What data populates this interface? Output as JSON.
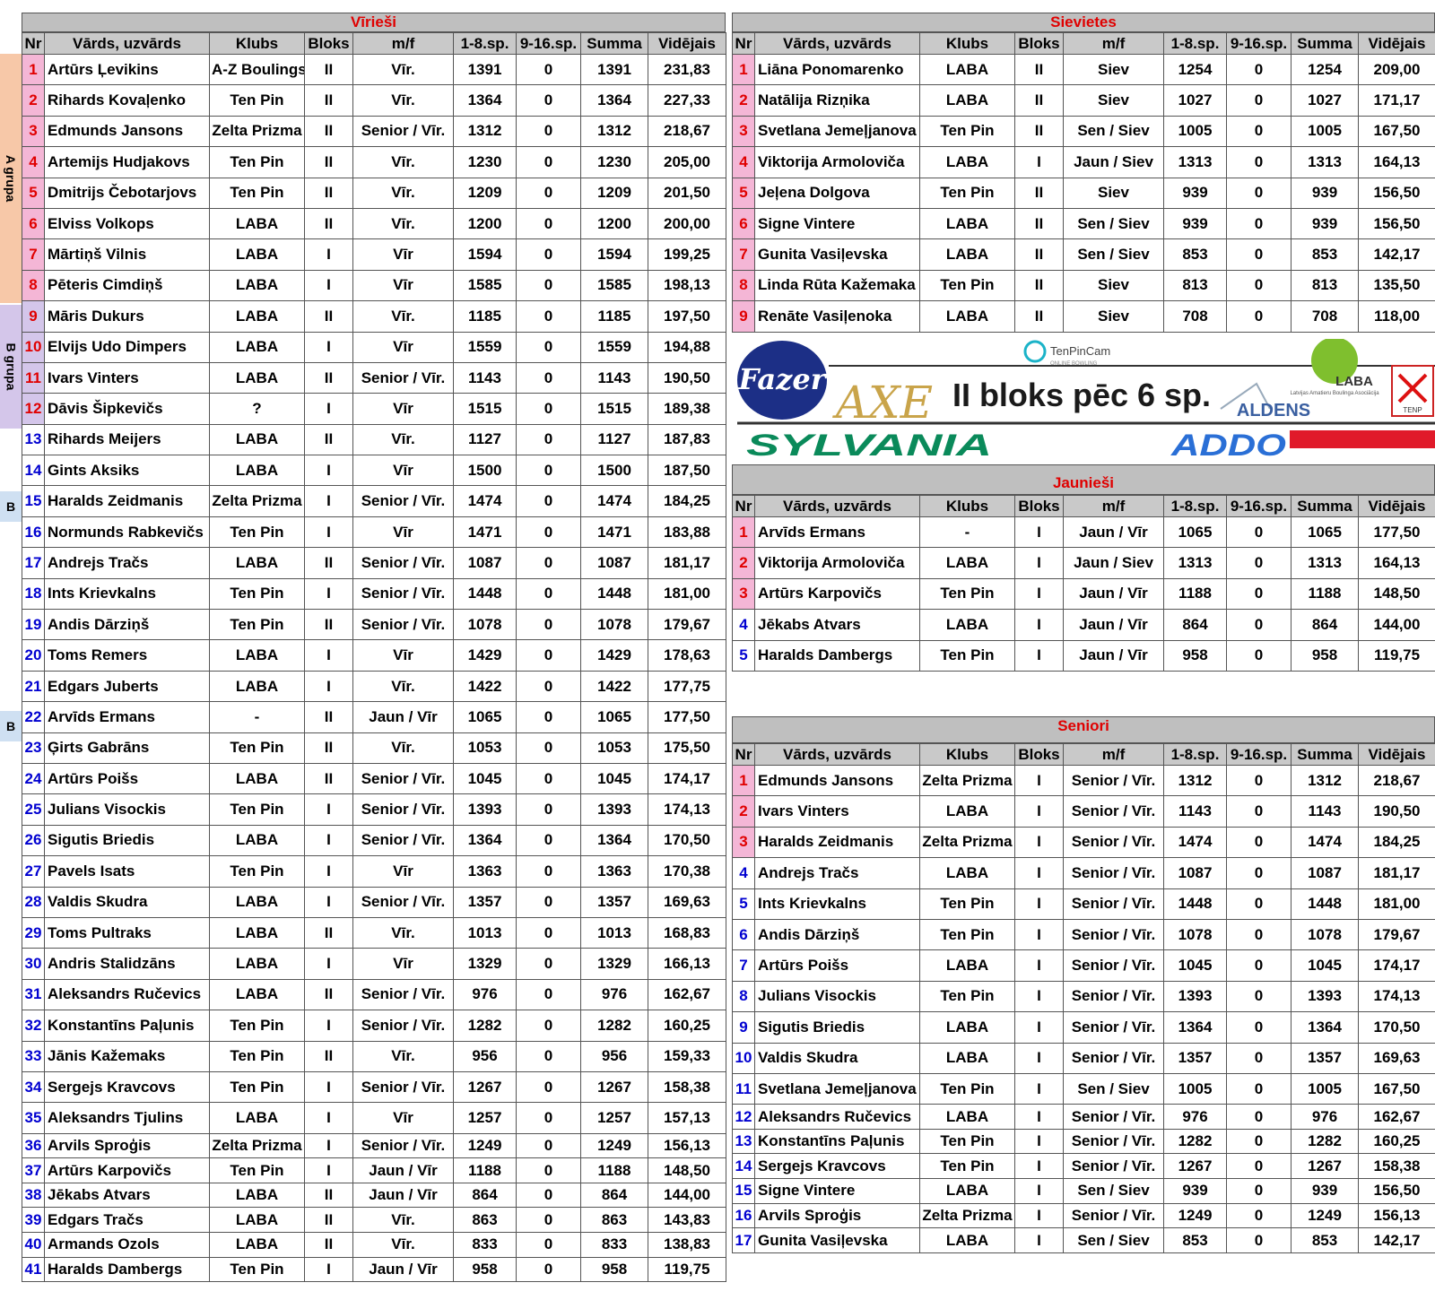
{
  "headers": [
    "Nr",
    "Vārds, uzvārds",
    "Klubs",
    "Bloks",
    "m/f",
    "1-8.sp.",
    "9-16.sp.",
    "Summa",
    "Vidējais"
  ],
  "side_labels": {
    "a_group": "A grupa",
    "b_group": "B grupa",
    "b1": "B",
    "b2": "B"
  },
  "men": {
    "title": "Vīrieši",
    "rows": [
      [
        "1",
        "Artūrs Ļevikins",
        "A-Z Boulings",
        "II",
        "Vīr.",
        "1391",
        "0",
        "1391",
        "231,83"
      ],
      [
        "2",
        "Rihards Kovaļenko",
        "Ten Pin",
        "II",
        "Vīr.",
        "1364",
        "0",
        "1364",
        "227,33"
      ],
      [
        "3",
        "Edmunds Jansons",
        "Zelta Prizma",
        "II",
        "Senior / Vīr.",
        "1312",
        "0",
        "1312",
        "218,67"
      ],
      [
        "4",
        "Artemijs Hudjakovs",
        "Ten Pin",
        "II",
        "Vīr.",
        "1230",
        "0",
        "1230",
        "205,00"
      ],
      [
        "5",
        "Dmitrijs Čebotarjovs",
        "Ten Pin",
        "II",
        "Vīr.",
        "1209",
        "0",
        "1209",
        "201,50"
      ],
      [
        "6",
        "Elviss Volkops",
        "LABA",
        "II",
        "Vīr.",
        "1200",
        "0",
        "1200",
        "200,00"
      ],
      [
        "7",
        "Mārtiņš Vilnis",
        "LABA",
        "I",
        "Vīr",
        "1594",
        "0",
        "1594",
        "199,25"
      ],
      [
        "8",
        "Pēteris Cimdiņš",
        "LABA",
        "I",
        "Vīr",
        "1585",
        "0",
        "1585",
        "198,13"
      ],
      [
        "9",
        "Māris Dukurs",
        "LABA",
        "II",
        "Vīr.",
        "1185",
        "0",
        "1185",
        "197,50"
      ],
      [
        "10",
        "Elvijs Udo Dimpers",
        "LABA",
        "I",
        "Vīr",
        "1559",
        "0",
        "1559",
        "194,88"
      ],
      [
        "11",
        "Ivars Vinters",
        "LABA",
        "II",
        "Senior / Vīr.",
        "1143",
        "0",
        "1143",
        "190,50"
      ],
      [
        "12",
        "Dāvis Šipkevičs",
        "?",
        "I",
        "Vīr",
        "1515",
        "0",
        "1515",
        "189,38"
      ],
      [
        "13",
        "Rihards Meijers",
        "LABA",
        "II",
        "Vīr.",
        "1127",
        "0",
        "1127",
        "187,83"
      ],
      [
        "14",
        "Gints Aksiks",
        "LABA",
        "I",
        "Vīr",
        "1500",
        "0",
        "1500",
        "187,50"
      ],
      [
        "15",
        "Haralds Zeidmanis",
        "Zelta Prizma",
        "I",
        "Senior / Vīr.",
        "1474",
        "0",
        "1474",
        "184,25"
      ],
      [
        "16",
        "Normunds Rabkevičs",
        "Ten Pin",
        "I",
        "Vīr",
        "1471",
        "0",
        "1471",
        "183,88"
      ],
      [
        "17",
        "Andrejs Tračs",
        "LABA",
        "II",
        "Senior / Vīr.",
        "1087",
        "0",
        "1087",
        "181,17"
      ],
      [
        "18",
        "Ints Krievkalns",
        "Ten Pin",
        "I",
        "Senior / Vīr.",
        "1448",
        "0",
        "1448",
        "181,00"
      ],
      [
        "19",
        "Andis Dārziņš",
        "Ten Pin",
        "II",
        "Senior / Vīr.",
        "1078",
        "0",
        "1078",
        "179,67"
      ],
      [
        "20",
        "Toms Remers",
        "LABA",
        "I",
        "Vīr",
        "1429",
        "0",
        "1429",
        "178,63"
      ],
      [
        "21",
        "Edgars Juberts",
        "LABA",
        "I",
        "Vīr.",
        "1422",
        "0",
        "1422",
        "177,75"
      ],
      [
        "22",
        "Arvīds Ermans",
        "-",
        "II",
        "Jaun / Vīr",
        "1065",
        "0",
        "1065",
        "177,50"
      ],
      [
        "23",
        "Ģirts Gabrāns",
        "Ten Pin",
        "II",
        "Vīr.",
        "1053",
        "0",
        "1053",
        "175,50"
      ],
      [
        "24",
        "Artūrs Poišs",
        "LABA",
        "II",
        "Senior / Vīr.",
        "1045",
        "0",
        "1045",
        "174,17"
      ],
      [
        "25",
        "Julians Visockis",
        "Ten Pin",
        "I",
        "Senior / Vīr.",
        "1393",
        "0",
        "1393",
        "174,13"
      ],
      [
        "26",
        "Sigutis Briedis",
        "LABA",
        "I",
        "Senior / Vīr.",
        "1364",
        "0",
        "1364",
        "170,50"
      ],
      [
        "27",
        "Pavels Isats",
        "Ten Pin",
        "I",
        "Vīr",
        "1363",
        "0",
        "1363",
        "170,38"
      ],
      [
        "28",
        "Valdis Skudra",
        "LABA",
        "I",
        "Senior / Vīr.",
        "1357",
        "0",
        "1357",
        "169,63"
      ],
      [
        "29",
        "Toms Pultraks",
        "LABA",
        "II",
        "Vīr.",
        "1013",
        "0",
        "1013",
        "168,83"
      ],
      [
        "30",
        "Andris Stalidzāns",
        "LABA",
        "I",
        "Vīr",
        "1329",
        "0",
        "1329",
        "166,13"
      ],
      [
        "31",
        "Aleksandrs Ručevics",
        "LABA",
        "II",
        "Senior / Vīr.",
        "976",
        "0",
        "976",
        "162,67"
      ],
      [
        "32",
        "Konstantīns Paļunis",
        "Ten Pin",
        "I",
        "Senior / Vīr.",
        "1282",
        "0",
        "1282",
        "160,25"
      ],
      [
        "33",
        "Jānis Kažemaks",
        "Ten Pin",
        "II",
        "Vīr.",
        "956",
        "0",
        "956",
        "159,33"
      ],
      [
        "34",
        "Sergejs Kravcovs",
        "Ten Pin",
        "I",
        "Senior / Vīr.",
        "1267",
        "0",
        "1267",
        "158,38"
      ],
      [
        "35",
        "Aleksandrs Tjulins",
        "LABA",
        "I",
        "Vīr",
        "1257",
        "0",
        "1257",
        "157,13"
      ],
      [
        "36",
        "Arvils Sproģis",
        "Zelta Prizma",
        "I",
        "Senior / Vīr.",
        "1249",
        "0",
        "1249",
        "156,13"
      ],
      [
        "37",
        "Artūrs Karpovičs",
        "Ten Pin",
        "I",
        "Jaun / Vīr",
        "1188",
        "0",
        "1188",
        "148,50"
      ],
      [
        "38",
        "Jēkabs Atvars",
        "LABA",
        "II",
        "Jaun / Vīr",
        "864",
        "0",
        "864",
        "144,00"
      ],
      [
        "39",
        "Edgars Tračs",
        "LABA",
        "II",
        "Vīr.",
        "863",
        "0",
        "863",
        "143,83"
      ],
      [
        "40",
        "Armands Ozols",
        "LABA",
        "II",
        "Vīr.",
        "833",
        "0",
        "833",
        "138,83"
      ],
      [
        "41",
        "Haralds Dambergs",
        "Ten Pin",
        "I",
        "Jaun / Vīr",
        "958",
        "0",
        "958",
        "119,75"
      ]
    ]
  },
  "women": {
    "title": "Sievietes",
    "rows": [
      [
        "1",
        "Liāna Ponomarenko",
        "LABA",
        "II",
        "Siev",
        "1254",
        "0",
        "1254",
        "209,00"
      ],
      [
        "2",
        "Natālija Rizņika",
        "LABA",
        "II",
        "Siev",
        "1027",
        "0",
        "1027",
        "171,17"
      ],
      [
        "3",
        "Svetlana Jemeļjanova",
        "Ten Pin",
        "II",
        "Sen / Siev",
        "1005",
        "0",
        "1005",
        "167,50"
      ],
      [
        "4",
        "Viktorija Armoloviča",
        "LABA",
        "I",
        "Jaun / Siev",
        "1313",
        "0",
        "1313",
        "164,13"
      ],
      [
        "5",
        "Jeļena Dolgova",
        "Ten Pin",
        "II",
        "Siev",
        "939",
        "0",
        "939",
        "156,50"
      ],
      [
        "6",
        "Signe Vintere",
        "LABA",
        "II",
        "Sen / Siev",
        "939",
        "0",
        "939",
        "156,50"
      ],
      [
        "7",
        "Gunita Vasiļevska",
        "LABA",
        "II",
        "Sen / Siev",
        "853",
        "0",
        "853",
        "142,17"
      ],
      [
        "8",
        "Linda Rūta Kažemaka",
        "Ten Pin",
        "II",
        "Siev",
        "813",
        "0",
        "813",
        "135,50"
      ],
      [
        "9",
        "Renāte Vasiļenoka",
        "LABA",
        "II",
        "Siev",
        "708",
        "0",
        "708",
        "118,00"
      ]
    ]
  },
  "juniors": {
    "title": "Jaunieši",
    "rows": [
      [
        "1",
        "Arvīds Ermans",
        "-",
        "I",
        "Jaun / Vīr",
        "1065",
        "0",
        "1065",
        "177,50"
      ],
      [
        "2",
        "Viktorija Armoloviča",
        "LABA",
        "I",
        "Jaun / Siev",
        "1313",
        "0",
        "1313",
        "164,13"
      ],
      [
        "3",
        "Artūrs Karpovičs",
        "Ten Pin",
        "I",
        "Jaun / Vīr",
        "1188",
        "0",
        "1188",
        "148,50"
      ],
      [
        "4",
        "Jēkabs Atvars",
        "LABA",
        "I",
        "Jaun / Vīr",
        "864",
        "0",
        "864",
        "144,00"
      ],
      [
        "5",
        "Haralds Dambergs",
        "Ten Pin",
        "I",
        "Jaun / Vīr",
        "958",
        "0",
        "958",
        "119,75"
      ]
    ]
  },
  "seniors": {
    "title": "Seniori",
    "rows": [
      [
        "1",
        "Edmunds Jansons",
        "Zelta Prizma",
        "I",
        "Senior / Vīr.",
        "1312",
        "0",
        "1312",
        "218,67"
      ],
      [
        "2",
        "Ivars Vinters",
        "LABA",
        "I",
        "Senior / Vīr.",
        "1143",
        "0",
        "1143",
        "190,50"
      ],
      [
        "3",
        "Haralds Zeidmanis",
        "Zelta Prizma",
        "I",
        "Senior / Vīr.",
        "1474",
        "0",
        "1474",
        "184,25"
      ],
      [
        "4",
        "Andrejs Tračs",
        "LABA",
        "I",
        "Senior / Vīr.",
        "1087",
        "0",
        "1087",
        "181,17"
      ],
      [
        "5",
        "Ints Krievkalns",
        "Ten Pin",
        "I",
        "Senior / Vīr.",
        "1448",
        "0",
        "1448",
        "181,00"
      ],
      [
        "6",
        "Andis Dārziņš",
        "Ten Pin",
        "I",
        "Senior / Vīr.",
        "1078",
        "0",
        "1078",
        "179,67"
      ],
      [
        "7",
        "Artūrs Poišs",
        "LABA",
        "I",
        "Senior / Vīr.",
        "1045",
        "0",
        "1045",
        "174,17"
      ],
      [
        "8",
        "Julians Visockis",
        "Ten Pin",
        "I",
        "Senior / Vīr.",
        "1393",
        "0",
        "1393",
        "174,13"
      ],
      [
        "9",
        "Sigutis Briedis",
        "LABA",
        "I",
        "Senior / Vīr.",
        "1364",
        "0",
        "1364",
        "170,50"
      ],
      [
        "10",
        "Valdis Skudra",
        "LABA",
        "I",
        "Senior / Vīr.",
        "1357",
        "0",
        "1357",
        "169,63"
      ],
      [
        "11",
        "Svetlana Jemeļjanova",
        "Ten Pin",
        "I",
        "Sen / Siev",
        "1005",
        "0",
        "1005",
        "167,50"
      ],
      [
        "12",
        "Aleksandrs Ručevics",
        "LABA",
        "I",
        "Senior / Vīr.",
        "976",
        "0",
        "976",
        "162,67"
      ],
      [
        "13",
        "Konstantīns Paļunis",
        "Ten Pin",
        "I",
        "Senior / Vīr.",
        "1282",
        "0",
        "1282",
        "160,25"
      ],
      [
        "14",
        "Sergejs Kravcovs",
        "Ten Pin",
        "I",
        "Senior / Vīr.",
        "1267",
        "0",
        "1267",
        "158,38"
      ],
      [
        "15",
        "Signe Vintere",
        "LABA",
        "I",
        "Sen / Siev",
        "939",
        "0",
        "939",
        "156,50"
      ],
      [
        "16",
        "Arvils Sproģis",
        "Zelta Prizma",
        "I",
        "Senior / Vīr.",
        "1249",
        "0",
        "1249",
        "156,13"
      ],
      [
        "17",
        "Gunita Vasiļevska",
        "LABA",
        "I",
        "Sen / Siev",
        "853",
        "0",
        "853",
        "142,17"
      ]
    ]
  },
  "banner": {
    "headline": "II bloks pēc 6 sp.",
    "fazer": "Fazer",
    "tenpincam": "TenPinCam",
    "tenpincam_sub": "ONLINE BOWLING",
    "laba": "LABA",
    "laba_sub": "Latvijas Amatieru Boulinga Asociācija",
    "aldens": "ALDENS",
    "sylvania": "SYLVANIA",
    "addo": "ADDO",
    "axe": "AXE",
    "tenpin": "TENP"
  },
  "colors": {
    "title_red": "#e00000",
    "nr_blue": "#0000d0",
    "pink": "#f4b6d6",
    "lavender": "#d4c6ea",
    "light_blue": "#cfe0f2",
    "peach": "#f7c8a8",
    "sylvania_green": "#0a8a5a",
    "addo_blue": "#2a6fd6",
    "fazer_blue": "#1c2f86"
  }
}
